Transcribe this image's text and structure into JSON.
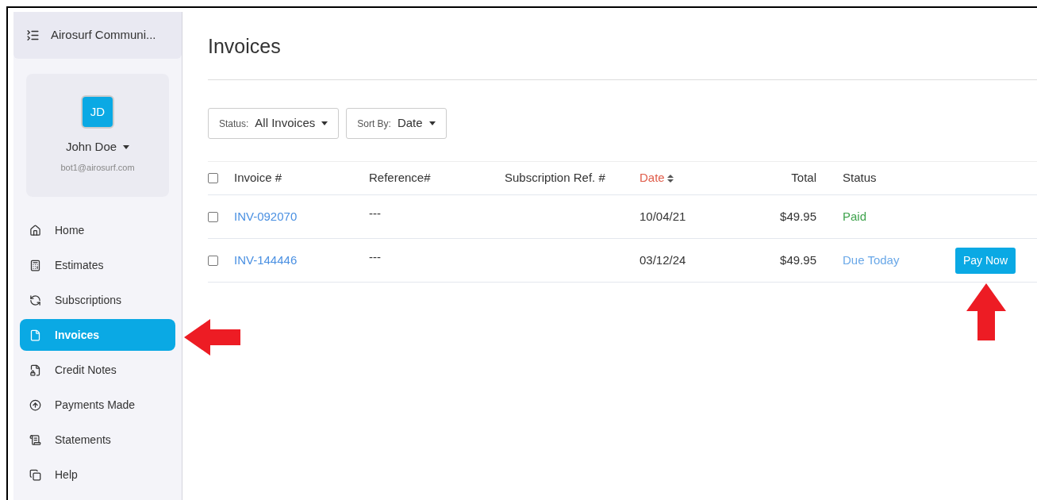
{
  "sidebar": {
    "org": "Airosurf Communi...",
    "user": {
      "initials": "JD",
      "name": "John Doe",
      "email": "bot1@airosurf.com"
    },
    "items": [
      {
        "label": "Home",
        "selected": false
      },
      {
        "label": "Estimates",
        "selected": false
      },
      {
        "label": "Subscriptions",
        "selected": false
      },
      {
        "label": "Invoices",
        "selected": true
      },
      {
        "label": "Credit Notes",
        "selected": false
      },
      {
        "label": "Payments Made",
        "selected": false
      },
      {
        "label": "Statements",
        "selected": false
      },
      {
        "label": "Help",
        "selected": false
      }
    ]
  },
  "page_title": "Invoices",
  "filters": [
    {
      "label": "Status:",
      "value": "All Invoices"
    },
    {
      "label": "Sort By:",
      "value": "Date"
    }
  ],
  "table": {
    "all_checked": false,
    "columns": [
      {
        "label": "Invoice #",
        "sorted": false
      },
      {
        "label": "Reference#",
        "sorted": false
      },
      {
        "label": "Subscription Ref. #",
        "sorted": false
      },
      {
        "label": "Date",
        "sorted": true
      },
      {
        "label": "Total",
        "sorted": false
      },
      {
        "label": "Status",
        "sorted": false
      }
    ],
    "rows": [
      {
        "checked": false,
        "invoice": "INV-092070",
        "reference": "---",
        "date": "10/04/21",
        "total": "$49.95",
        "status": "Paid",
        "kind": "paid"
      },
      {
        "checked": false,
        "invoice": "INV-144446",
        "reference": "---",
        "date": "03/12/24",
        "total": "$49.95",
        "status": "Due Today",
        "kind": "due",
        "action": "Pay Now"
      }
    ]
  }
}
